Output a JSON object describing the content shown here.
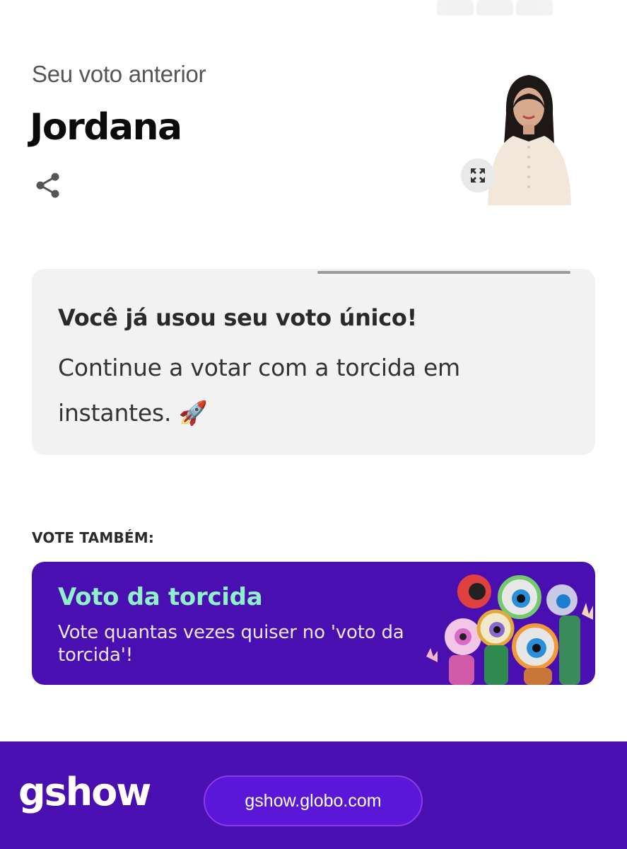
{
  "previous_vote": {
    "label": "Seu voto anterior",
    "name": "Jordana"
  },
  "icons": {
    "share": "share-icon",
    "expand": "expand-icon"
  },
  "notice": {
    "title": "Você já usou seu voto único!",
    "body": "Continue a votar com a torcida em instantes. 🚀",
    "progress_fraction": 1.0
  },
  "vote_also": {
    "label": "VOTE TAMBÉM:"
  },
  "promo": {
    "title": "Voto da torcida",
    "body": "Vote quantas vezes quiser no 'voto da torcida'!"
  },
  "footer": {
    "logo": "gshow",
    "url": "gshow.globo.com"
  },
  "colors": {
    "brand_purple": "#4a0fb0",
    "promo_title": "#8ff0c9",
    "pill": "#5a17d8"
  }
}
